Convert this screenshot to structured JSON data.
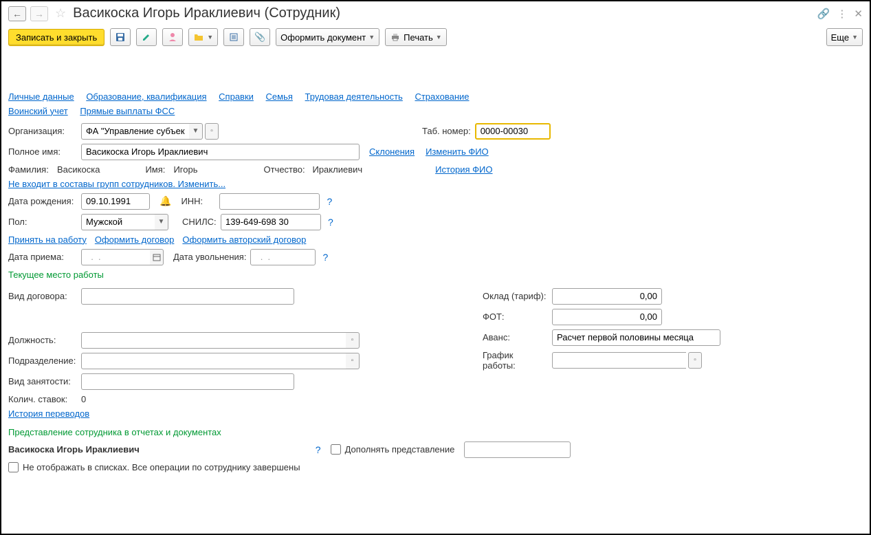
{
  "header": {
    "title": "Васикоска Игорь Ираклиевич (Сотрудник)"
  },
  "toolbar": {
    "save_close": "Записать и закрыть",
    "doc": "Оформить документ",
    "print": "Печать",
    "more": "Еще"
  },
  "nav": {
    "personal": "Личные данные",
    "edu": "Образование, квалификация",
    "ref": "Справки",
    "family": "Семья",
    "work": "Трудовая деятельность",
    "insurance": "Страхование",
    "military": "Воинский учет",
    "fss": "Прямые выплаты ФСС"
  },
  "org": {
    "label": "Организация:",
    "value": "ФА \"Управление субъекта"
  },
  "tab": {
    "label": "Таб. номер:",
    "value": "0000-00030"
  },
  "name": {
    "label": "Полное имя:",
    "value": "Васикоска Игорь Ираклиевич",
    "decl": "Склонения",
    "change": "Изменить ФИО"
  },
  "last": {
    "label": "Фамилия:",
    "value": "Васикоска"
  },
  "first": {
    "label": "Имя:",
    "value": "Игорь"
  },
  "middle": {
    "label": "Отчество:",
    "value": "Ираклиевич"
  },
  "history": "История ФИО",
  "groups": "Не входит в составы групп сотрудников. Изменить...",
  "dob": {
    "label": "Дата рождения:",
    "value": "09.10.1991"
  },
  "inn": {
    "label": "ИНН:",
    "value": ""
  },
  "sex": {
    "label": "Пол:",
    "value": "Мужской"
  },
  "snils": {
    "label": "СНИЛС:",
    "value": "139-649-698 30"
  },
  "actions": {
    "hire": "Принять на работу",
    "contract": "Оформить договор",
    "author": "Оформить авторский договор"
  },
  "hiredate": {
    "label": "Дата приема:",
    "value": "  .  .  "
  },
  "firedate": {
    "label": "Дата увольнения:",
    "value": "  .  .  "
  },
  "workplace": "Текущее место работы",
  "contract_type": {
    "label": "Вид договора:",
    "value": ""
  },
  "position": {
    "label": "Должность:",
    "value": ""
  },
  "dept": {
    "label": "Подразделение:",
    "value": ""
  },
  "emp_type": {
    "label": "Вид занятости:",
    "value": ""
  },
  "rate": {
    "label": "Колич. ставок:",
    "value": "0"
  },
  "transfers": "История переводов",
  "salary": {
    "label": "Оклад (тариф):",
    "value": "0,00"
  },
  "fot": {
    "label": "ФОТ:",
    "value": "0,00"
  },
  "advance": {
    "label": "Аванс:",
    "value": "Расчет первой половины месяца"
  },
  "schedule": {
    "label": "График работы:",
    "value": ""
  },
  "repr": {
    "title": "Представление сотрудника в отчетах и документах",
    "name": "Васикоска Игорь Ираклиевич",
    "add": "Дополнять представление"
  },
  "hide": "Не отображать в списках. Все операции по сотруднику завершены"
}
